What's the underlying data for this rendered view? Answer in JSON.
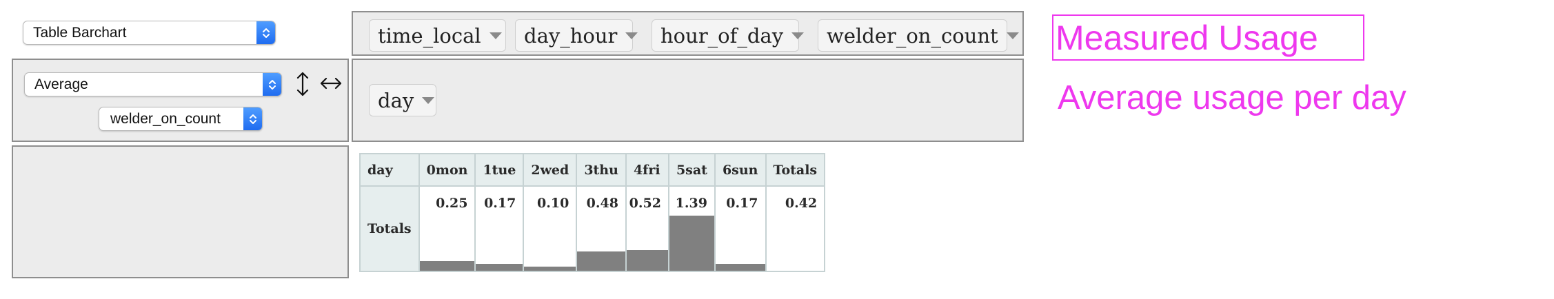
{
  "renderer_select": {
    "value": "Table Barchart",
    "icon": "updown-chevrons-icon"
  },
  "aggregator_select": {
    "value": "Average",
    "icon": "updown-chevrons-icon"
  },
  "attribute_select": {
    "value": "welder_on_count",
    "icon": "updown-chevrons-icon"
  },
  "row_order_toggle": {
    "symbol": "↕",
    "icon": "vertical-arrows-icon"
  },
  "col_order_toggle": {
    "symbol": "↔",
    "icon": "horizontal-arrows-icon"
  },
  "unused_attributes": [
    "time_local",
    "day_hour",
    "hour_of_day",
    "welder_on_count"
  ],
  "col_attributes": [
    "day"
  ],
  "row_attributes": [],
  "pivot_table": {
    "col_header": "day",
    "columns": [
      "0mon",
      "1tue",
      "2wed",
      "3thu",
      "4fri",
      "5sat",
      "6sun"
    ],
    "totals_label": "Totals",
    "row_label": "Totals",
    "values": [
      "0.25",
      "0.17",
      "0.10",
      "0.48",
      "0.52",
      "1.39",
      "0.17"
    ],
    "grand_total": "0.42",
    "bar_color": "#808080"
  },
  "title": "Measured Usage",
  "subtitle": "Average usage per day",
  "accent_color": "#ee38ee"
}
